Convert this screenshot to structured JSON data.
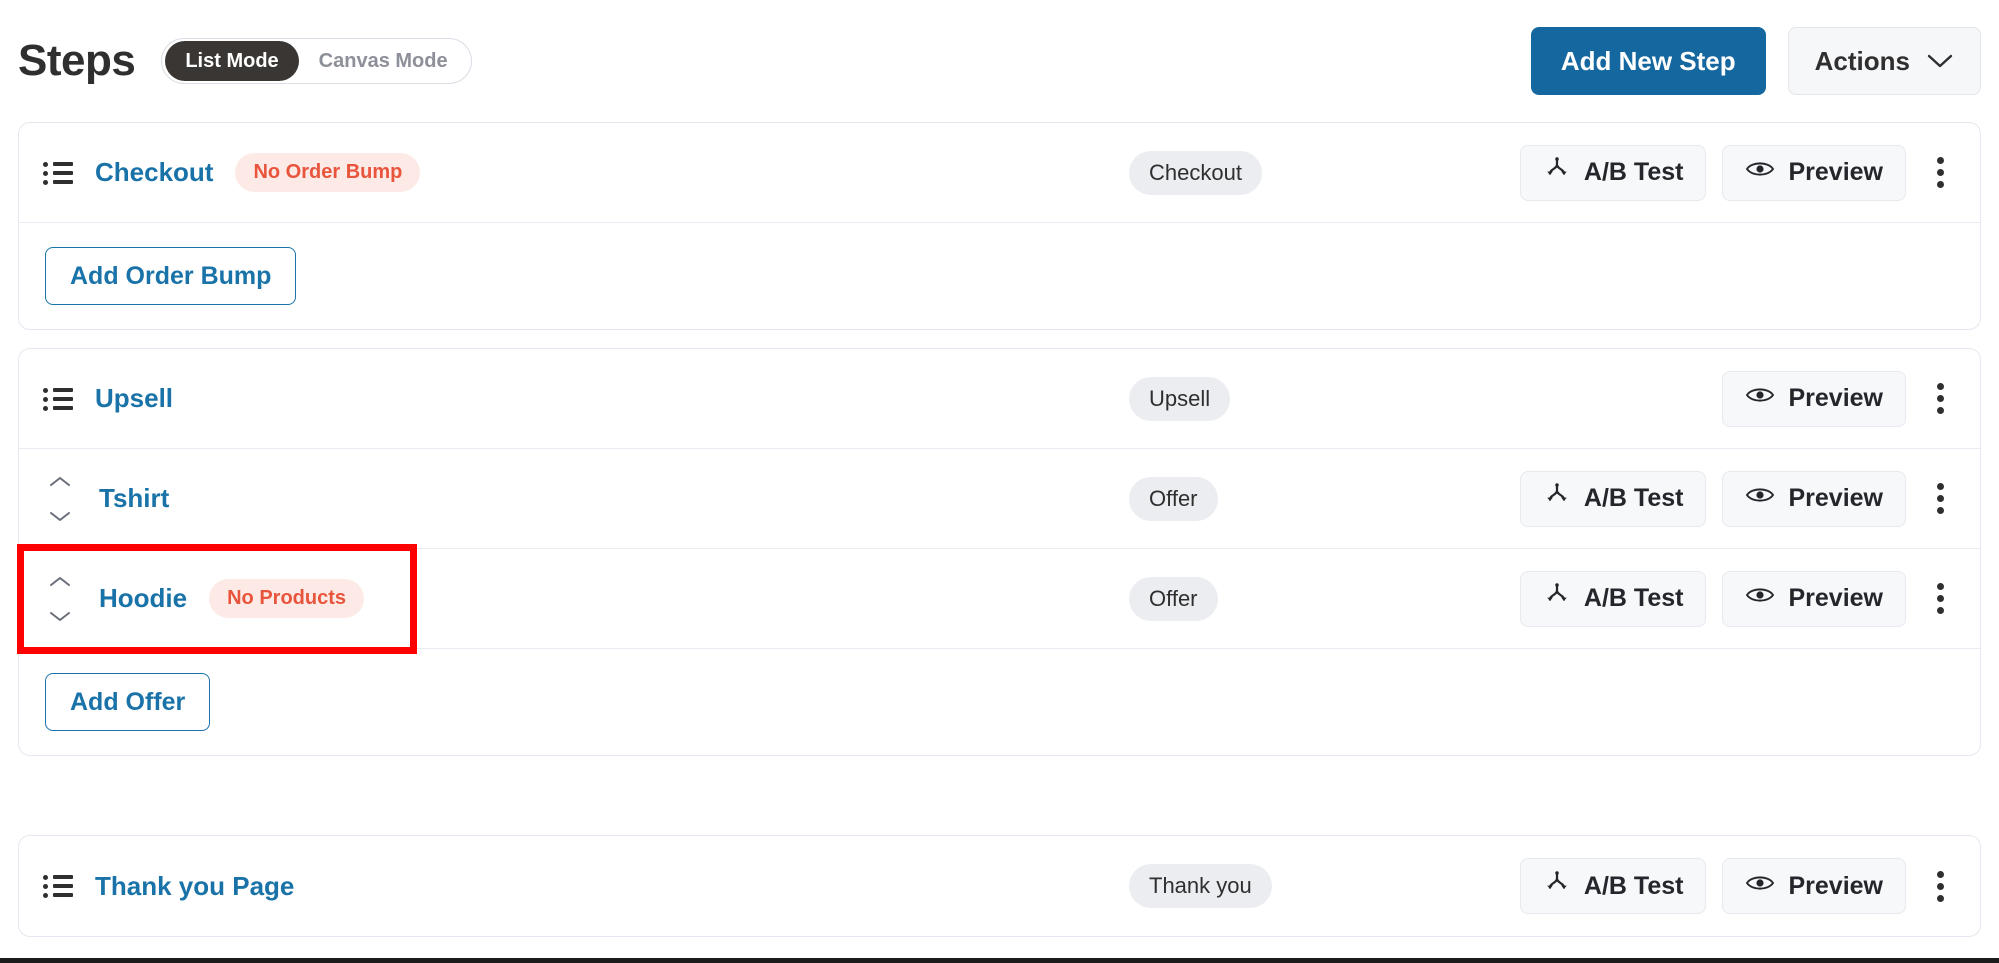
{
  "header": {
    "title": "Steps",
    "modes": [
      {
        "label": "List Mode",
        "active": true
      },
      {
        "label": "Canvas Mode",
        "active": false
      }
    ],
    "add_new_step_label": "Add New Step",
    "actions_label": "Actions",
    "actions_icon": "chevron-down-icon",
    "primary_color": "#15689f"
  },
  "labels": {
    "ab_test": "A/B Test",
    "preview": "Preview",
    "ab_test_icon": "split-branch-icon",
    "preview_icon": "eye-icon",
    "kebab_icon": "more-vertical-icon",
    "list_icon": "list-icon",
    "sort_icon": "sort-up-down-icon"
  },
  "colors": {
    "link": "#1a73a8",
    "warn_badge_bg": "#fdeae6",
    "warn_badge_text": "#e8543c",
    "type_badge_bg": "#ebedf1",
    "highlight": "#ff0000"
  },
  "cards": [
    {
      "id": "checkout-card",
      "rows": [
        {
          "name": "Checkout",
          "handle": "list-icon",
          "warning": "No Order Bump",
          "type": "Checkout",
          "has_ab_test": true,
          "has_preview": true,
          "has_kebab": true,
          "highlighted": false
        }
      ],
      "action": {
        "label": "Add Order Bump",
        "name": "add-order-bump-button"
      }
    },
    {
      "id": "upsell-card",
      "rows": [
        {
          "name": "Upsell",
          "handle": "list-icon",
          "warning": "",
          "type": "Upsell",
          "has_ab_test": false,
          "has_preview": true,
          "has_kebab": true,
          "highlighted": false
        },
        {
          "name": "Tshirt",
          "handle": "sort-icon",
          "warning": "",
          "type": "Offer",
          "has_ab_test": true,
          "has_preview": true,
          "has_kebab": true,
          "highlighted": false
        },
        {
          "name": "Hoodie",
          "handle": "sort-icon",
          "warning": "No Products",
          "type": "Offer",
          "has_ab_test": true,
          "has_preview": true,
          "has_kebab": true,
          "highlighted": true
        }
      ],
      "action": {
        "label": "Add Offer",
        "name": "add-offer-button"
      }
    },
    {
      "id": "thank-you-card",
      "rows": [
        {
          "name": "Thank you Page",
          "handle": "list-icon",
          "warning": "",
          "type": "Thank you",
          "has_ab_test": true,
          "has_preview": true,
          "has_kebab": true,
          "highlighted": false
        }
      ],
      "action": null
    }
  ]
}
